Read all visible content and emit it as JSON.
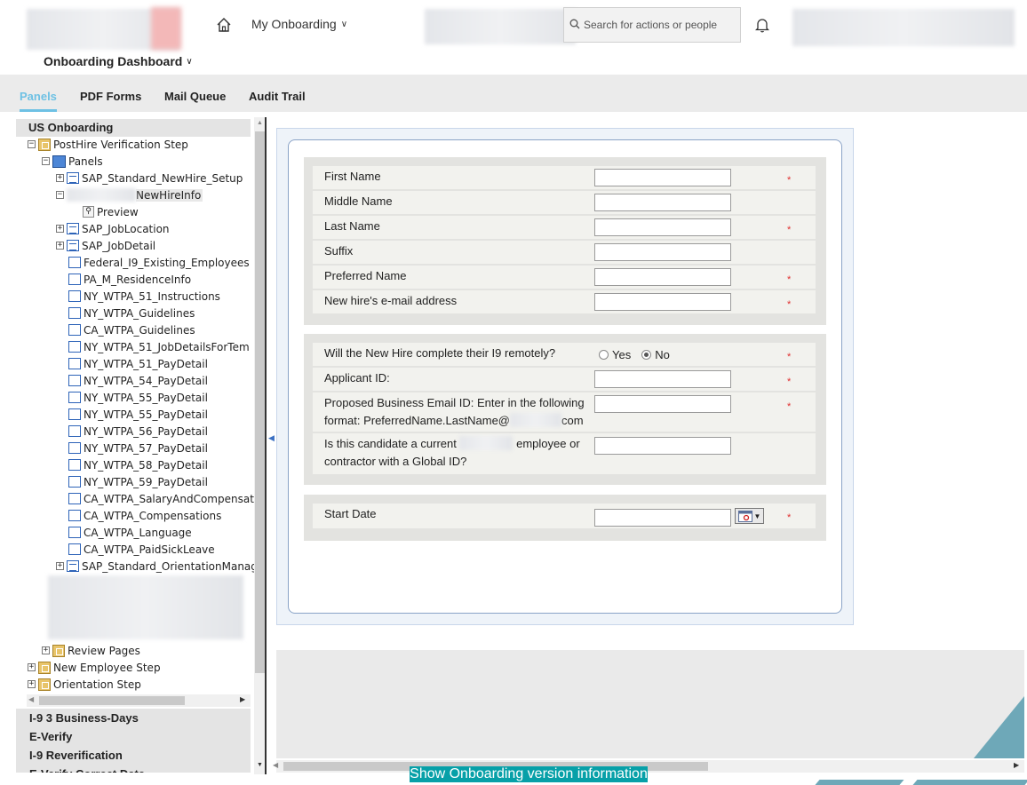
{
  "header": {
    "home_icon": "home-icon",
    "onboarding_menu": "My Onboarding",
    "search_placeholder": "Search for actions or people",
    "dashboard_title": "Onboarding Dashboard",
    "bell_icon": "bell-icon"
  },
  "tabs": [
    "Panels",
    "PDF Forms",
    "Mail Queue",
    "Audit Trail"
  ],
  "tree": {
    "root": "US Onboarding",
    "step1": "PostHire Verification Step",
    "panels": "Panels",
    "items": [
      "SAP_Standard_NewHire_Setup",
      "NewHireInfo",
      "Preview",
      "SAP_JobLocation",
      "SAP_JobDetail",
      "Federal_I9_Existing_Employees",
      "PA_M_ResidenceInfo",
      "NY_WTPA_51_Instructions",
      "NY_WTPA_Guidelines",
      "CA_WTPA_Guidelines",
      "NY_WTPA_51_JobDetailsForTem",
      "NY_WTPA_51_PayDetail",
      "NY_WTPA_54_PayDetail",
      "NY_WTPA_55_PayDetail",
      "NY_WTPA_55_PayDetail",
      "NY_WTPA_56_PayDetail",
      "NY_WTPA_57_PayDetail",
      "NY_WTPA_58_PayDetail",
      "NY_WTPA_59_PayDetail",
      "CA_WTPA_SalaryAndCompensat",
      "CA_WTPA_Compensations",
      "CA_WTPA_Language",
      "CA_WTPA_PaidSickLeave",
      "SAP_Standard_OrientationManag"
    ],
    "review_pages": "Review Pages",
    "new_employee_step": "New Employee Step",
    "orientation_step": "Orientation Step",
    "sections": [
      "I-9 3 Business-Days",
      "E-Verify",
      "I-9 Reverification",
      "E-Verify Correct Data"
    ]
  },
  "form": {
    "first_name": "First Name",
    "middle_name": "Middle Name",
    "last_name": "Last Name",
    "suffix": "Suffix",
    "preferred_name": "Preferred Name",
    "email": "New hire's e-mail address",
    "i9_remote": "Will the New Hire complete their I9 remotely?",
    "yes": "Yes",
    "no": "No",
    "applicant_id": "Applicant ID:",
    "proposed_email_1": "Proposed Business Email ID: Enter in the following",
    "proposed_email_2": "format: PreferredName.LastName@",
    "proposed_email_3": "com",
    "current_emp_1": "Is this candidate a current",
    "current_emp_2": "employee or",
    "current_emp_3": "contractor with a Global ID?",
    "start_date": "Start Date",
    "required_mark": "*"
  },
  "footer": {
    "version_button": "Show Onboarding version information"
  }
}
